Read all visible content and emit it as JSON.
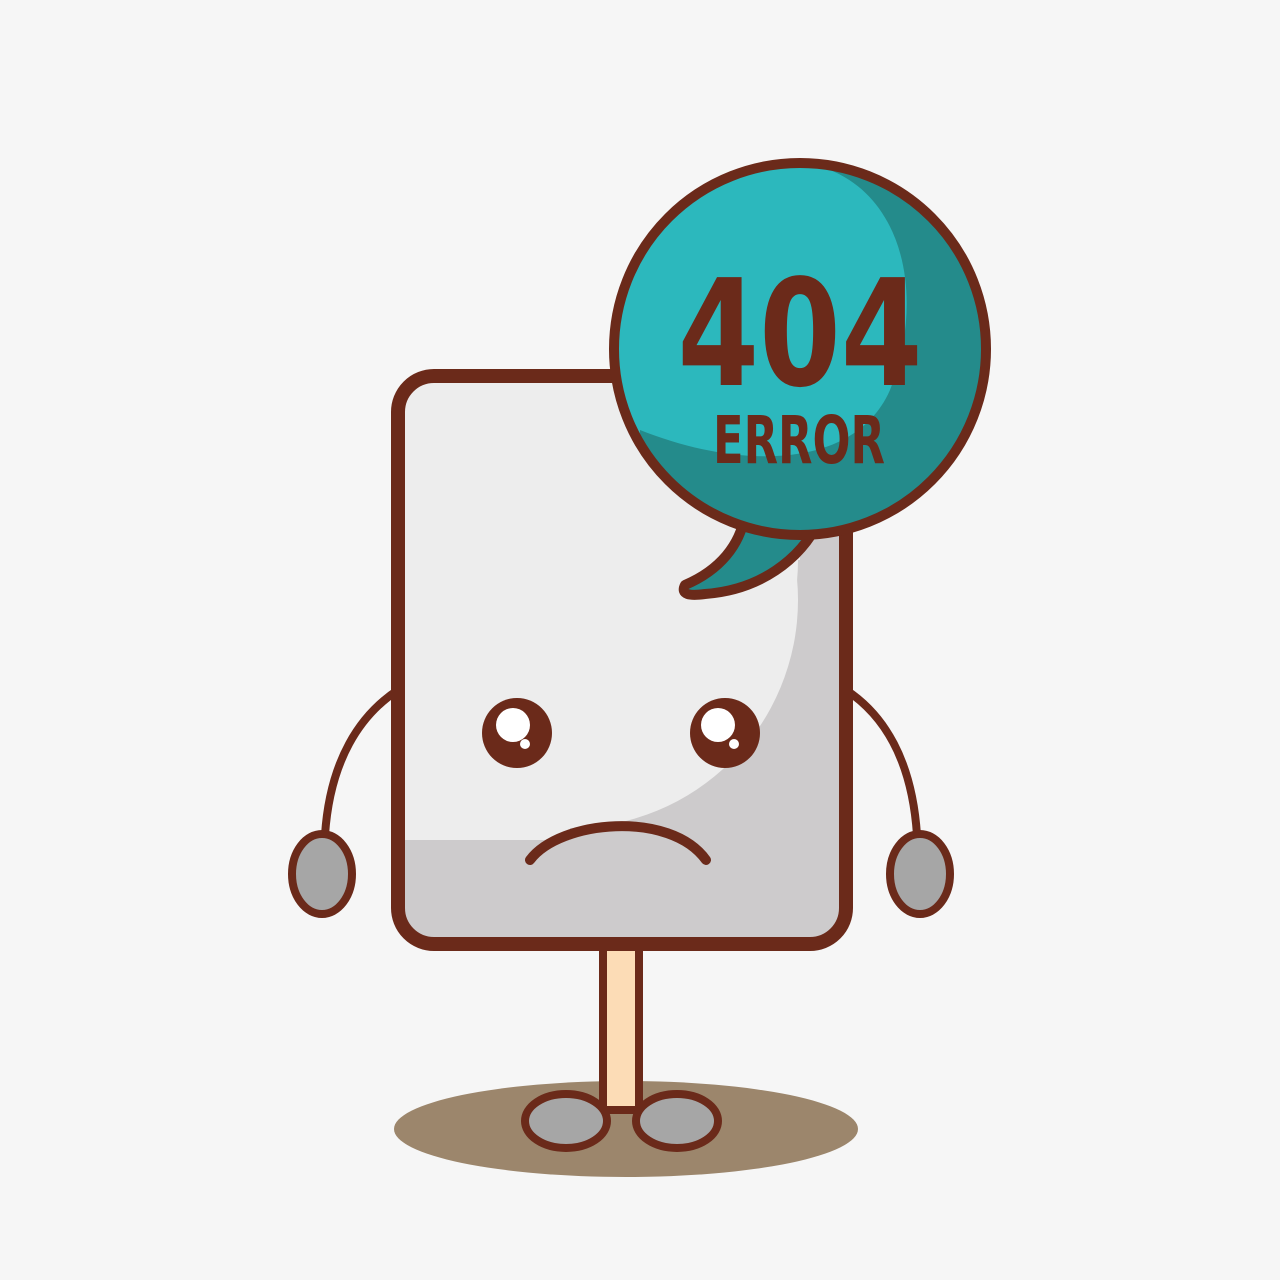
{
  "error": {
    "code": "404",
    "label": "ERROR"
  },
  "illustration": {
    "subject": "sad-document-character",
    "icons": [
      "speech-bubble-icon",
      "document-character-icon"
    ]
  },
  "colors": {
    "background": "#f6f6f6",
    "outline": "#6b2a1a",
    "body_light": "#ededed",
    "body_shade": "#cdcbcc",
    "bubble": "#2cb8bd",
    "bubble_shade": "#248b8b",
    "leg": "#fcdcb6",
    "foot": "#a6a6a6",
    "shadow": "#9c866c"
  }
}
